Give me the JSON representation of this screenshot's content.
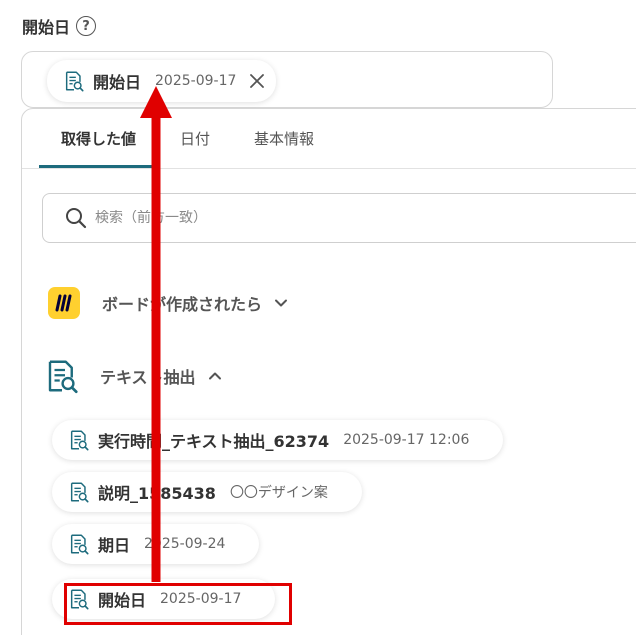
{
  "field": {
    "label": "開始日",
    "help_icon": "?",
    "selected": {
      "name": "開始日",
      "value": "2025-09-17"
    }
  },
  "tabs": [
    {
      "label": "取得した値",
      "active": true
    },
    {
      "label": "日付",
      "active": false
    },
    {
      "label": "基本情報",
      "active": false
    }
  ],
  "search": {
    "placeholder": "検索（前方一致）"
  },
  "sections": [
    {
      "label": "ボードが作成されたら",
      "icon": "miro-logo-icon",
      "expanded": false
    },
    {
      "label": "テキスト抽出",
      "icon": "document-search-icon",
      "expanded": true
    }
  ],
  "items": [
    {
      "name": "実行時間_テキスト抽出_62374",
      "value": "2025-09-17 12:06"
    },
    {
      "name": "説明_1585438",
      "value": "〇〇デザイン案"
    },
    {
      "name": "期日",
      "value": "2025-09-24"
    },
    {
      "name": "開始日",
      "value": "2025-09-17"
    }
  ],
  "colors": {
    "accent": "#1d6b7d",
    "annotation": "#e00000",
    "miro": "#ffd02f"
  }
}
